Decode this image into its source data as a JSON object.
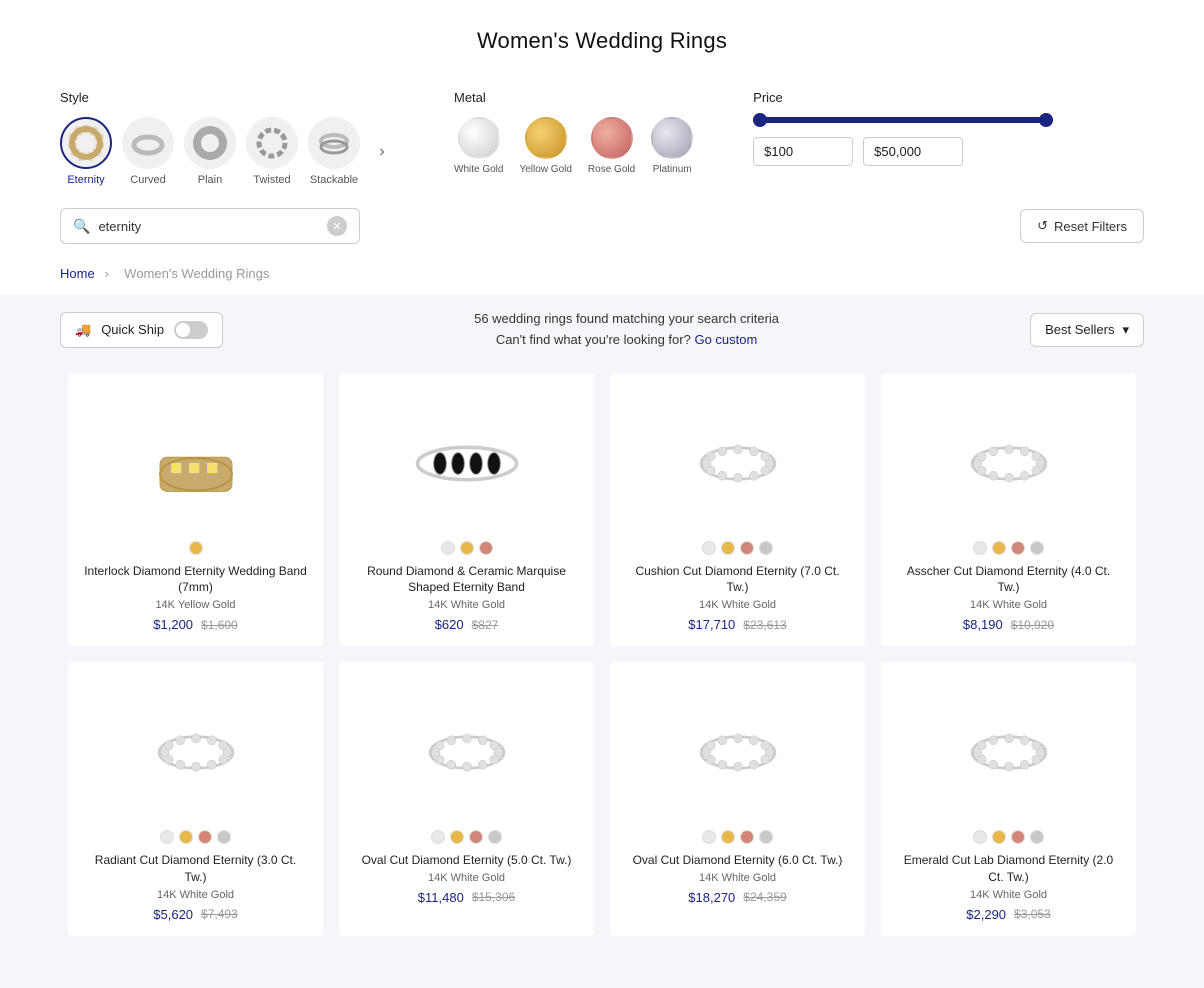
{
  "page": {
    "title": "Women's Wedding Rings"
  },
  "breadcrumb": {
    "home": "Home",
    "separator": "›",
    "current": "Women's Wedding Rings"
  },
  "style_filter": {
    "label": "Style",
    "items": [
      {
        "id": "eternity",
        "label": "Eternity",
        "active": true
      },
      {
        "id": "curved",
        "label": "Curved",
        "active": false
      },
      {
        "id": "plain",
        "label": "Plain",
        "active": false
      },
      {
        "id": "twisted",
        "label": "Twisted",
        "active": false
      },
      {
        "id": "stackable",
        "label": "Stackable",
        "active": false
      }
    ]
  },
  "metal_filter": {
    "label": "Metal",
    "items": [
      {
        "id": "white-gold",
        "label": "White Gold",
        "color": "#e8e8e8"
      },
      {
        "id": "yellow-gold",
        "label": "Yellow Gold",
        "color": "#e8b84b"
      },
      {
        "id": "rose-gold",
        "label": "Rose Gold",
        "color": "#d4857a"
      },
      {
        "id": "platinum",
        "label": "Platinum",
        "color": "#c8c8c8"
      }
    ]
  },
  "price_filter": {
    "label": "Price",
    "min": "$100",
    "max": "$50,000"
  },
  "search": {
    "value": "eternity",
    "placeholder": "eternity"
  },
  "reset_button": "Reset Filters",
  "results": {
    "count_text": "56 wedding rings found matching your search criteria",
    "custom_text": "Can't find what you're looking for?",
    "custom_link": "Go custom"
  },
  "quick_ship": {
    "label": "Quick Ship"
  },
  "sort": {
    "label": "Best Sellers"
  },
  "products": [
    {
      "name": "Interlock Diamond Eternity Wedding Band (7mm)",
      "metal": "14K Yellow Gold",
      "price_sale": "$1,200",
      "price_orig": "$1,600",
      "swatches": [
        "#e8b84b"
      ],
      "ring_color": "#c8a96e",
      "ring_style": "wide"
    },
    {
      "name": "Round Diamond & Ceramic Marquise Shaped Eternity Band",
      "metal": "14K White Gold",
      "price_sale": "$620",
      "price_orig": "$827",
      "swatches": [
        "#e8e8e8",
        "#e8b84b",
        "#d4857a"
      ],
      "ring_color": "#aaa",
      "ring_style": "thin"
    },
    {
      "name": "Cushion Cut Diamond Eternity (7.0 Ct. Tw.)",
      "metal": "14K White Gold",
      "price_sale": "$17,710",
      "price_orig": "$23,613",
      "swatches": [
        "#e8e8e8",
        "#e8b84b",
        "#d4857a",
        "#c8c8c8"
      ],
      "ring_color": "#bbb",
      "ring_style": "wide"
    },
    {
      "name": "Asscher Cut Diamond Eternity (4.0 Ct. Tw.)",
      "metal": "14K White Gold",
      "price_sale": "$8,190",
      "price_orig": "$10,920",
      "swatches": [
        "#e8e8e8",
        "#e8b84b",
        "#d4857a",
        "#c8c8c8"
      ],
      "ring_color": "#bbb",
      "ring_style": "wide"
    },
    {
      "name": "Radiant Cut Diamond Eternity (3.0 Ct. Tw.)",
      "metal": "14K White Gold",
      "price_sale": "$5,620",
      "price_orig": "$7,493",
      "swatches": [
        "#e8e8e8",
        "#e8b84b",
        "#d4857a",
        "#c8c8c8"
      ],
      "ring_color": "#bbb",
      "ring_style": "medium"
    },
    {
      "name": "Oval Cut Diamond Eternity (5.0 Ct. Tw.)",
      "metal": "14K White Gold",
      "price_sale": "$11,480",
      "price_orig": "$15,306",
      "swatches": [
        "#e8e8e8",
        "#e8b84b",
        "#d4857a",
        "#c8c8c8"
      ],
      "ring_color": "#aaa",
      "ring_style": "medium"
    },
    {
      "name": "Oval Cut Diamond Eternity (6.0 Ct. Tw.)",
      "metal": "14K White Gold",
      "price_sale": "$18,270",
      "price_orig": "$24,359",
      "swatches": [
        "#e8e8e8",
        "#e8b84b",
        "#d4857a",
        "#c8c8c8"
      ],
      "ring_color": "#aaa",
      "ring_style": "medium"
    },
    {
      "name": "Emerald Cut Lab Diamond Eternity (2.0 Ct. Tw.)",
      "metal": "14K White Gold",
      "price_sale": "$2,290",
      "price_orig": "$3,053",
      "swatches": [
        "#e8e8e8",
        "#e8b84b",
        "#d4857a",
        "#c8c8c8"
      ],
      "ring_color": "#bbb",
      "ring_style": "medium"
    }
  ]
}
